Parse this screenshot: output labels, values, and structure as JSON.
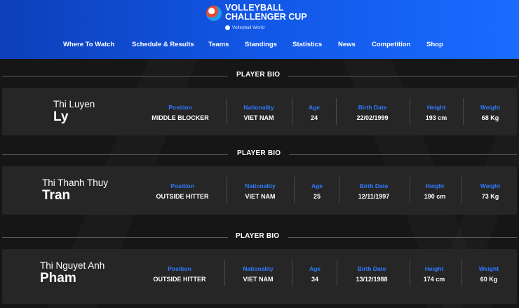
{
  "header": {
    "logo_line1": "VOLLEYBALL",
    "logo_line2": "CHALLENGER CUP",
    "logo_sub": "Volleyball World",
    "nav": [
      "Where To Watch",
      "Schedule & Results",
      "Teams",
      "Standings",
      "Statistics",
      "News",
      "Competition",
      "Shop"
    ]
  },
  "section_title": "PLAYER BIO",
  "labels": {
    "position": "Position",
    "nationality": "Nationality",
    "age": "Age",
    "birth_date": "Birth Date",
    "height": "Height",
    "weight": "Weight"
  },
  "players": [
    {
      "first": "Thi Luyen",
      "last": "Ly",
      "position": "MIDDLE BLOCKER",
      "nationality": "VIET NAM",
      "age": "24",
      "birth_date": "22/02/1999",
      "height": "193 cm",
      "weight": "68 Kg"
    },
    {
      "first": "Thi Thanh Thuy",
      "last": "Tran",
      "position": "OUTSIDE HITTER",
      "nationality": "VIET NAM",
      "age": "25",
      "birth_date": "12/11/1997",
      "height": "190 cm",
      "weight": "73 Kg"
    },
    {
      "first": "Thi Nguyet Anh",
      "last": "Pham",
      "position": "OUTSIDE HITTER",
      "nationality": "VIET NAM",
      "age": "34",
      "birth_date": "13/12/1988",
      "height": "174 cm",
      "weight": "60 Kg"
    }
  ],
  "colors": {
    "header_blue": "#1257e6",
    "label_blue": "#2f7bff",
    "card_bg": "#262626",
    "page_bg": "#161616"
  }
}
